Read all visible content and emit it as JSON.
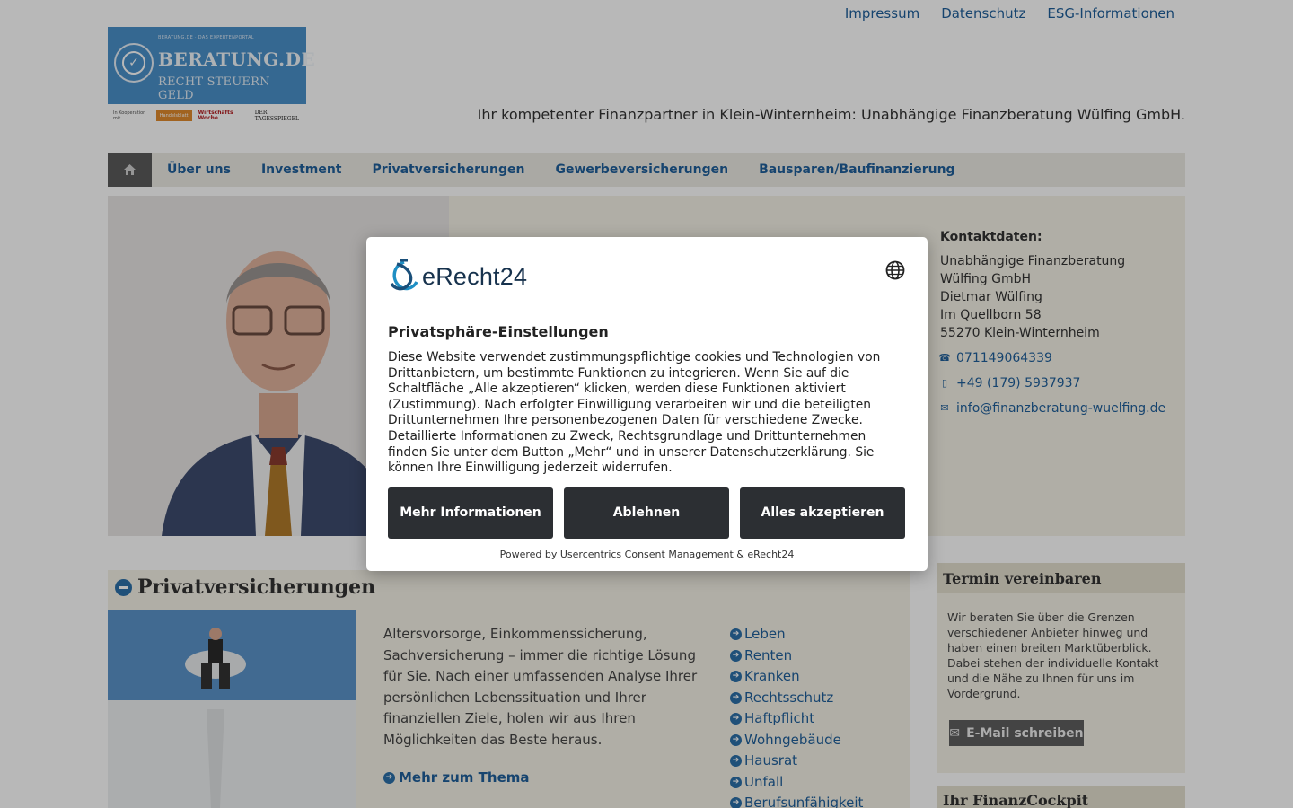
{
  "top_links": [
    "Impressum",
    "Datenschutz",
    "ESG-Informationen"
  ],
  "logo": {
    "top": "BERATUNG.DE · DAS EXPERTENPORTAL",
    "main": "BERATUNG.DE",
    "sub": "RECHT STEUERN GELD",
    "partners_lead": "In Kooperation mit",
    "partner1": "Handelsblatt",
    "partner2": "Wirtschafts Woche",
    "partner3": "DER TAGESSPIEGEL"
  },
  "tagline": "Ihr kompetenter Finanzpartner in Klein-Winternheim: Unabhängige Finanzberatung Wülfing GmbH.",
  "nav": {
    "home_icon": "home-icon",
    "items": [
      "Über uns",
      "Investment",
      "Privatversicherungen",
      "Gewerbeversicherungen",
      "Bausparen/Baufinanzierung"
    ]
  },
  "contact": {
    "heading": "Kontaktdaten:",
    "company": "Unabhängige Finanzberatung Wülfing GmbH",
    "name": "Dietmar Wülfing",
    "street": "Im Quellborn 58",
    "city": "55270 Klein-Winternheim",
    "phone": "071149064339",
    "mobile": "+49 (179) 5937937",
    "email": "info@finanzberatung-wuelfing.de"
  },
  "section": {
    "title": "Privatversicherungen",
    "text": "Altersvorsorge, Einkommenssicherung, Sachversicherung – immer die richtige Lösung für Sie. Nach einer umfassenden Analyse Ihrer persönlichen Lebenssituation und Ihrer finanziellen Ziele, holen wir aus Ihren Möglichkeiten das Beste heraus.",
    "more": "Mehr zum Thema",
    "links": [
      "Leben",
      "Renten",
      "Kranken",
      "Rechtsschutz",
      "Haftpflicht",
      "Wohngebäude",
      "Hausrat",
      "Unfall",
      "Berufsunfähigkeit"
    ]
  },
  "sidebar": {
    "termin_title": "Termin vereinbaren",
    "termin_text": "Wir beraten Sie über die Grenzen verschiedener Anbieter hinweg und haben einen breiten Marktüberblick. Dabei stehen der individuelle Kontakt und die Nähe zu Ihnen für uns im Vordergrund.",
    "mail_button": "E-Mail schreiben",
    "cockpit_title": "Ihr FinanzCockpit"
  },
  "consent": {
    "brand": "eRecht24",
    "title": "Privatsphäre-Einstellungen",
    "text": "Diese Website verwendet zustimmungspflichtige cookies und Technologien von Drittanbietern, um bestimmte Funktionen zu integrieren. Wenn Sie auf die Schaltfläche „Alle akzeptieren“ klicken, werden diese Funktionen aktiviert (Zustimmung). Nach erfolgter Einwilligung verarbeiten wir und die beteiligten Drittunternehmen Ihre personenbezogenen Daten für verschiedene Zwecke. Detaillierte Informationen zu Zweck, Rechtsgrundlage und Drittunternehmen finden Sie unter dem Button „Mehr“ und in unserer Datenschutzerklärung. Sie können Ihre Einwilligung jederzeit widerrufen.",
    "btn_more": "Mehr Informationen",
    "btn_decline": "Ablehnen",
    "btn_accept": "Alles akzeptieren",
    "powered": "Powered by Usercentrics Consent Management & eRecht24"
  },
  "colors": {
    "link": "#1f5f9a",
    "panel": "#f4f1e6",
    "button_dark": "#2c2f33",
    "overlay": "rgba(0,0,0,0.28)"
  }
}
